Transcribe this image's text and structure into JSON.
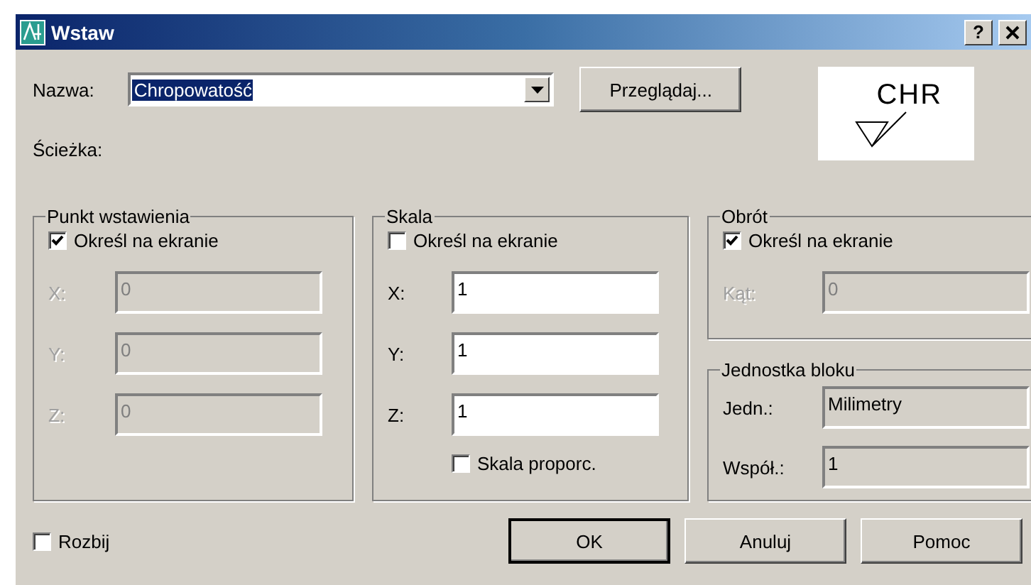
{
  "window": {
    "title": "Wstaw",
    "help_button": "?"
  },
  "name": {
    "label": "Nazwa:",
    "value": "Chropowatość",
    "browse_button": "Przeglądaj..."
  },
  "preview": {
    "text": "CHR"
  },
  "path": {
    "label": "Ścieżka:"
  },
  "insertion_point": {
    "title": "Punkt wstawienia",
    "specify": {
      "label": "Określ na ekranie",
      "checked": true
    },
    "fields": [
      {
        "label": "X:",
        "value": "0",
        "disabled": true
      },
      {
        "label": "Y:",
        "value": "0",
        "disabled": true
      },
      {
        "label": "Z:",
        "value": "0",
        "disabled": true
      }
    ]
  },
  "scale": {
    "title": "Skala",
    "specify": {
      "label": "Określ na ekranie",
      "checked": false
    },
    "fields": [
      {
        "label": "X:",
        "value": "1",
        "disabled": false
      },
      {
        "label": "Y:",
        "value": "1",
        "disabled": false
      },
      {
        "label": "Z:",
        "value": "1",
        "disabled": false
      }
    ],
    "uniform": {
      "label": "Skala proporc.",
      "checked": false
    }
  },
  "rotation": {
    "title": "Obrót",
    "specify": {
      "label": "Określ na ekranie",
      "checked": true
    },
    "fields": [
      {
        "label": "Kąt:",
        "value": "0",
        "disabled": true
      }
    ]
  },
  "block_unit": {
    "title": "Jednostka bloku",
    "rows": [
      {
        "label": "Jedn.:",
        "value": "Milimetry"
      },
      {
        "label": "Współ.:",
        "value": "1"
      }
    ]
  },
  "explode": {
    "label": "Rozbij",
    "checked": false
  },
  "buttons": [
    {
      "label": "OK",
      "default": true
    },
    {
      "label": "Anuluj",
      "default": false
    },
    {
      "label": "Pomoc",
      "default": false
    }
  ]
}
